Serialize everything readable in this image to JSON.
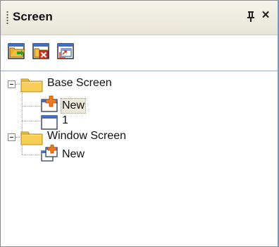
{
  "panel": {
    "title": "Screen",
    "pin_glyph": "⩜",
    "close_glyph": "×"
  },
  "toolbar": {
    "buttons": [
      {
        "icon": "open-screen-icon"
      },
      {
        "icon": "delete-screen-icon"
      },
      {
        "icon": "screen-properties-icon"
      }
    ]
  },
  "tree": {
    "nodes": [
      {
        "label": "Base Screen",
        "icon": "folder-icon",
        "expanded": true,
        "children": [
          {
            "label": "New",
            "icon": "new-screen-icon",
            "selected": true
          },
          {
            "label": "1",
            "icon": "screen-window-icon"
          }
        ]
      },
      {
        "label": "Window Screen",
        "icon": "folder-icon",
        "expanded": true,
        "children": [
          {
            "label": "New",
            "icon": "new-window-screen-icon"
          }
        ]
      }
    ]
  },
  "colors": {
    "titlebar_top": "#f6f4ec",
    "titlebar_bottom": "#e8e5d7",
    "folder": "#f5c842",
    "selection": "#ece9d8",
    "panel_border": "#7a96bd"
  }
}
